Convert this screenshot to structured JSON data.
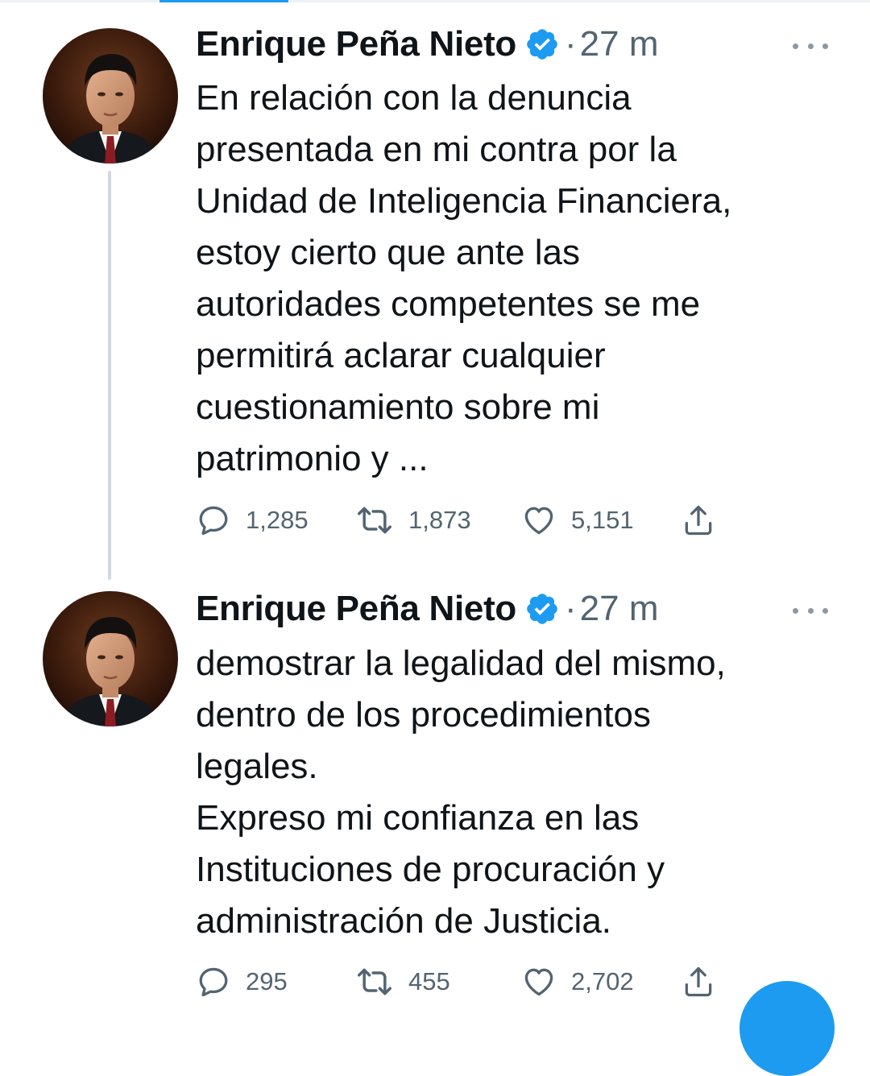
{
  "tweets": [
    {
      "author": {
        "name": "Enrique Peña Nieto",
        "verified": true
      },
      "separator": "·",
      "time": "27 m",
      "lines": [
        "En relación con la denuncia",
        "presentada en mi contra por la",
        "Unidad de Inteligencia Financiera,",
        "estoy cierto que ante las",
        "autoridades competentes se me",
        "permitirá aclarar cualquier",
        "cuestionamiento sobre mi",
        "patrimonio y ..."
      ],
      "stats": {
        "replies": "1,285",
        "retweets": "1,873",
        "likes": "5,151"
      }
    },
    {
      "author": {
        "name": "Enrique Peña Nieto",
        "verified": true
      },
      "separator": "·",
      "time": "27 m",
      "lines": [
        "demostrar la legalidad del mismo,",
        "dentro de los procedimientos",
        "legales.",
        "Expreso mi confianza en las",
        "Instituciones de procuración y",
        "administración de Justicia."
      ],
      "stats": {
        "replies": "295",
        "retweets": "455",
        "likes": "2,702"
      }
    }
  ],
  "colors": {
    "accent": "#1d9bf0",
    "text": "#0f1419",
    "secondary": "#536471",
    "thread_line": "#cfd9de"
  },
  "icons": {
    "verified": "verified-badge-icon",
    "more": "more-dots-icon",
    "reply": "reply-bubble-icon",
    "retweet": "retweet-icon",
    "like": "heart-icon",
    "share": "share-upload-icon"
  }
}
